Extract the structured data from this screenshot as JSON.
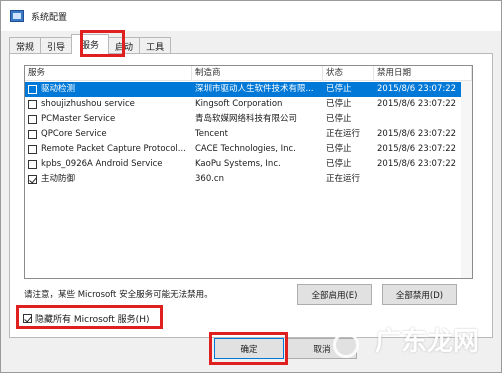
{
  "window": {
    "title": "系统配置"
  },
  "tabs": [
    {
      "label": "常规"
    },
    {
      "label": "引导"
    },
    {
      "label": "服务"
    },
    {
      "label": "启动"
    },
    {
      "label": "工具"
    }
  ],
  "columns": {
    "service": "服务",
    "manufacturer": "制造商",
    "status": "状态",
    "disabled_date": "禁用日期"
  },
  "rows": [
    {
      "name": "驱动检测",
      "manufacturer": "深圳市驱动人生软件技术有限...",
      "status": "已停止",
      "date": "2015/8/6 23:07:22",
      "checked": false
    },
    {
      "name": "shoujizhushou service",
      "manufacturer": "Kingsoft Corporation",
      "status": "已停止",
      "date": "2015/8/6 23:07:22",
      "checked": false
    },
    {
      "name": "PCMaster Service",
      "manufacturer": "青岛软媒网络科技有限公司",
      "status": "已停止",
      "date": "",
      "checked": false
    },
    {
      "name": "QPCore Service",
      "manufacturer": "Tencent",
      "status": "正在运行",
      "date": "2015/8/6 23:07:22",
      "checked": false
    },
    {
      "name": "Remote Packet Capture Protocol...",
      "manufacturer": "CACE Technologies, Inc.",
      "status": "已停止",
      "date": "2015/8/6 23:07:22",
      "checked": false
    },
    {
      "name": "kpbs_0926A Android Service",
      "manufacturer": "KaoPu Systems, Inc.",
      "status": "已停止",
      "date": "2015/8/6 23:07:22",
      "checked": false
    },
    {
      "name": "主动防御",
      "manufacturer": "360.cn",
      "status": "正在运行",
      "date": "",
      "checked": true
    }
  ],
  "notice": "请注意，某些 Microsoft 安全服务可能无法禁用。",
  "buttons": {
    "enable_all": "全部启用(E)",
    "disable_all": "全部禁用(D)",
    "ok": "确定",
    "cancel": "取消"
  },
  "hide_ms": {
    "label": "隐藏所有 Microsoft 服务(H)",
    "checked": true
  },
  "watermark": "广东龙网",
  "colors": {
    "selection": "#0078d7",
    "highlight_box": "#e0201f"
  }
}
